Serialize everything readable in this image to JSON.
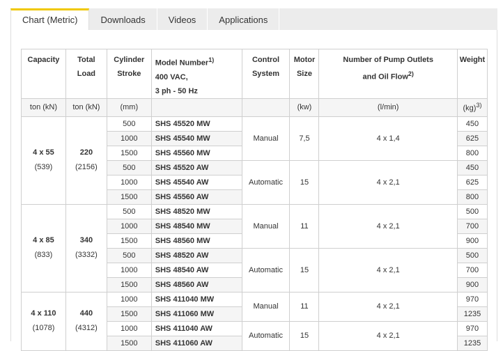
{
  "tabs": [
    "Chart (Metric)",
    "Downloads",
    "Videos",
    "Applications"
  ],
  "headers": {
    "capacity": "Capacity",
    "total_load_1": "Total",
    "total_load_2": "Load",
    "stroke_1": "Cylinder",
    "stroke_2": "Stroke",
    "model_1": "Model Number",
    "model_sup": "1)",
    "model_2": "400 VAC,",
    "model_3": "3 ph - 50 Hz",
    "control_1": "Control",
    "control_2": "System",
    "motor_1": "Motor",
    "motor_2": "Size",
    "pump_1": "Number of Pump Outlets",
    "pump_2": "and Oil Flow",
    "pump_sup": "2)",
    "weight": "Weight"
  },
  "units": {
    "capacity": "ton (kN)",
    "total_load": "ton (kN)",
    "stroke": "(mm)",
    "motor": "(kw)",
    "pump": "(l/min)",
    "weight": "(kg)",
    "weight_sup": "3)"
  },
  "groups": [
    {
      "capacity": "4 x 55",
      "capacity_kn": "(539)",
      "load": "220",
      "load_kn": "(2156)"
    },
    {
      "capacity": "4 x 85",
      "capacity_kn": "(833)",
      "load": "340",
      "load_kn": "(3332)"
    },
    {
      "capacity": "4 x 110",
      "capacity_kn": "(1078)",
      "load": "440",
      "load_kn": "(4312)"
    }
  ],
  "controls": [
    {
      "system": "Manual",
      "motor": "7,5",
      "pump": "4 x 1,4"
    },
    {
      "system": "Automatic",
      "motor": "15",
      "pump": "4 x 2,1"
    },
    {
      "system": "Manual",
      "motor": "11",
      "pump": "4 x 2,1"
    },
    {
      "system": "Automatic",
      "motor": "15",
      "pump": "4 x 2,1"
    },
    {
      "system": "Manual",
      "motor": "11",
      "pump": "4 x 2,1"
    },
    {
      "system": "Automatic",
      "motor": "15",
      "pump": "4 x 2,1"
    }
  ],
  "rows": [
    {
      "stroke": "500",
      "model": "SHS 45520 MW",
      "weight": "450"
    },
    {
      "stroke": "1000",
      "model": "SHS 45540 MW",
      "weight": "625"
    },
    {
      "stroke": "1500",
      "model": "SHS 45560 MW",
      "weight": "800"
    },
    {
      "stroke": "500",
      "model": "SHS 45520 AW",
      "weight": "450"
    },
    {
      "stroke": "1000",
      "model": "SHS 45540 AW",
      "weight": "625"
    },
    {
      "stroke": "1500",
      "model": "SHS 45560 AW",
      "weight": "800"
    },
    {
      "stroke": "500",
      "model": "SHS 48520 MW",
      "weight": "500"
    },
    {
      "stroke": "1000",
      "model": "SHS 48540 MW",
      "weight": "700"
    },
    {
      "stroke": "1500",
      "model": "SHS 48560 MW",
      "weight": "900"
    },
    {
      "stroke": "500",
      "model": "SHS 48520 AW",
      "weight": "500"
    },
    {
      "stroke": "1000",
      "model": "SHS 48540 AW",
      "weight": "700"
    },
    {
      "stroke": "1500",
      "model": "SHS 48560 AW",
      "weight": "900"
    },
    {
      "stroke": "1000",
      "model": "SHS 411040 MW",
      "weight": "970"
    },
    {
      "stroke": "1500",
      "model": "SHS 411060 MW",
      "weight": "1235"
    },
    {
      "stroke": "1000",
      "model": "SHS 411040 AW",
      "weight": "970"
    },
    {
      "stroke": "1500",
      "model": "SHS 411060 AW",
      "weight": "1235"
    }
  ],
  "accent_color": "#f0c800"
}
